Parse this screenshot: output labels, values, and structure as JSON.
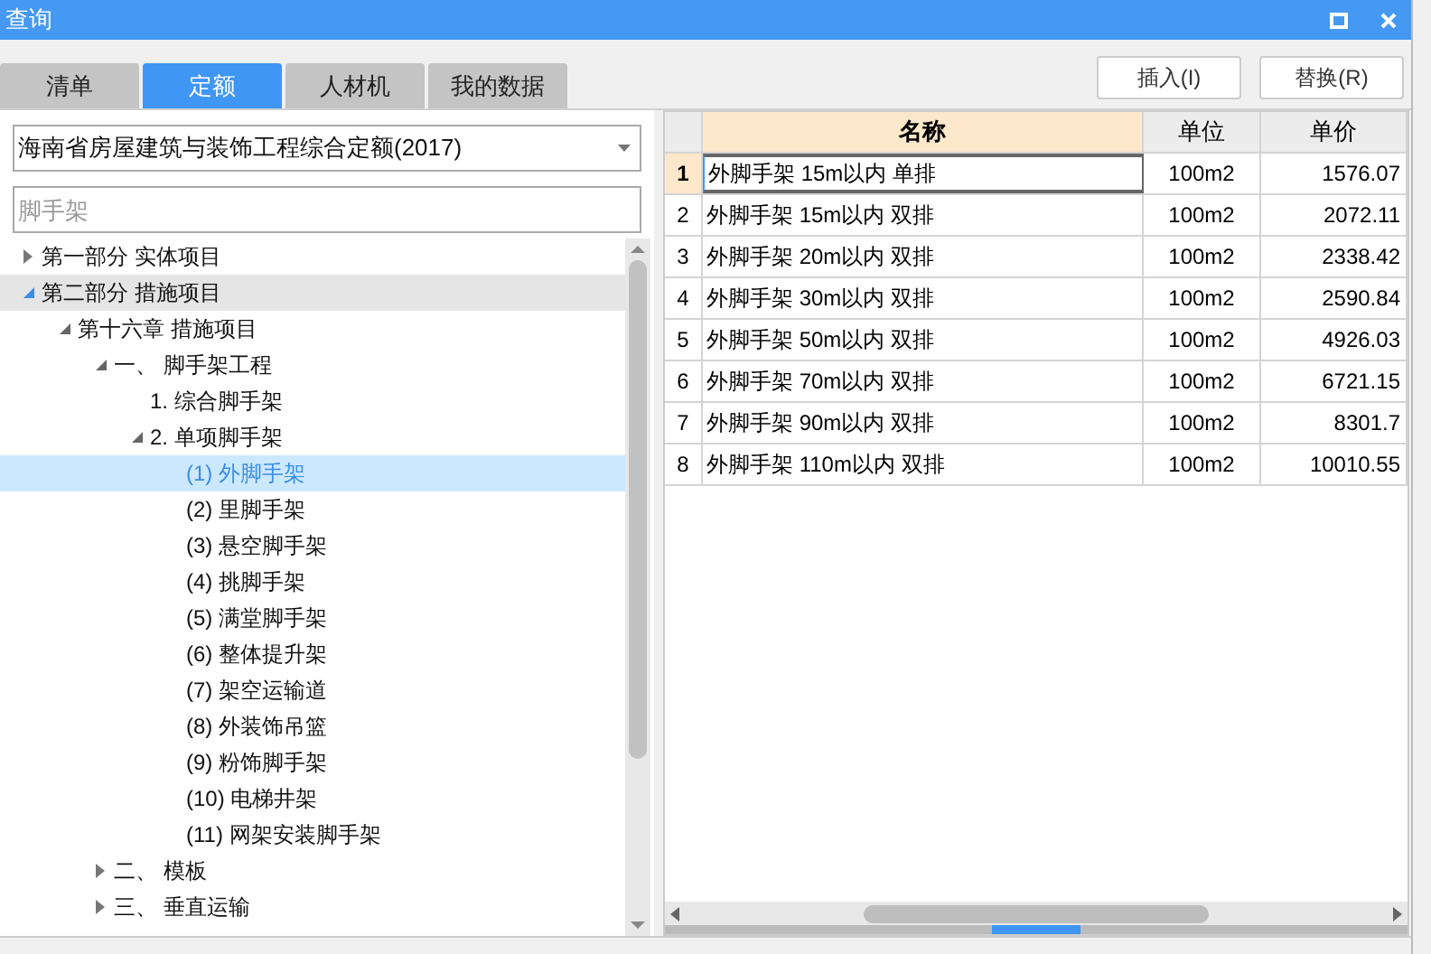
{
  "window": {
    "title": "查询"
  },
  "tabs": [
    {
      "label": "清单",
      "selected": false
    },
    {
      "label": "定额",
      "selected": true
    },
    {
      "label": "人材机",
      "selected": false
    },
    {
      "label": "我的数据",
      "selected": false
    }
  ],
  "buttons": [
    "插入(I)",
    "替换(R)"
  ],
  "quota_select": {
    "value": "海南省房屋建筑与装饰工程综合定额(2017)"
  },
  "search": {
    "placeholder": "脚手架"
  },
  "tree": [
    {
      "label": "第一部分 实体项目",
      "expanded": false,
      "selected": false,
      "highlighted": false
    },
    {
      "label": "第二部分 措施项目",
      "expanded": true,
      "selected": false,
      "highlighted": true,
      "children": [
        {
          "label": "第十六章 措施项目",
          "expanded": true,
          "selected": false,
          "highlighted": false,
          "children": [
            {
              "label": "一、 脚手架工程",
              "expanded": true,
              "selected": false,
              "highlighted": false,
              "children": [
                {
                  "label": "1. 综合脚手架",
                  "selected": false,
                  "highlighted": false
                },
                {
                  "label": "2. 单项脚手架",
                  "expanded": true,
                  "selected": false,
                  "highlighted": false,
                  "children": [
                    {
                      "label": "(1) 外脚手架",
                      "selected": true,
                      "highlighted": false
                    },
                    {
                      "label": "(2) 里脚手架",
                      "selected": false,
                      "highlighted": false
                    },
                    {
                      "label": "(3) 悬空脚手架",
                      "selected": false,
                      "highlighted": false
                    },
                    {
                      "label": "(4) 挑脚手架",
                      "selected": false,
                      "highlighted": false
                    },
                    {
                      "label": "(5) 满堂脚手架",
                      "selected": false,
                      "highlighted": false
                    },
                    {
                      "label": "(6) 整体提升架",
                      "selected": false,
                      "highlighted": false
                    },
                    {
                      "label": "(7) 架空运输道",
                      "selected": false,
                      "highlighted": false
                    },
                    {
                      "label": "(8) 外装饰吊篮",
                      "selected": false,
                      "highlighted": false
                    },
                    {
                      "label": "(9) 粉饰脚手架",
                      "selected": false,
                      "highlighted": false
                    },
                    {
                      "label": "(10) 电梯井架",
                      "selected": false,
                      "highlighted": false
                    },
                    {
                      "label": "(11) 网架安装脚手架",
                      "selected": false,
                      "highlighted": false
                    }
                  ]
                }
              ]
            },
            {
              "label": "二、 模板",
              "expanded": false,
              "selected": false,
              "highlighted": false
            },
            {
              "label": "三、 垂直运输",
              "expanded": false,
              "selected": false,
              "highlighted": false
            }
          ]
        }
      ]
    }
  ],
  "table": {
    "columns": [
      {
        "label": "名称",
        "selected": true
      },
      {
        "label": "单位",
        "selected": false
      },
      {
        "label": "单价",
        "selected": false
      }
    ],
    "rows": [
      {
        "index": "1",
        "name": "外脚手架 15m以内 单排",
        "unit": "100m2",
        "price": "1576.07",
        "selected": true
      },
      {
        "index": "2",
        "name": "外脚手架 15m以内 双排",
        "unit": "100m2",
        "price": "2072.11",
        "selected": false
      },
      {
        "index": "3",
        "name": "外脚手架 20m以内 双排",
        "unit": "100m2",
        "price": "2338.42",
        "selected": false
      },
      {
        "index": "4",
        "name": "外脚手架 30m以内 双排",
        "unit": "100m2",
        "price": "2590.84",
        "selected": false
      },
      {
        "index": "5",
        "name": "外脚手架 50m以内 双排",
        "unit": "100m2",
        "price": "4926.03",
        "selected": false
      },
      {
        "index": "6",
        "name": "外脚手架 70m以内 双排",
        "unit": "100m2",
        "price": "6721.15",
        "selected": false
      },
      {
        "index": "7",
        "name": "外脚手架 90m以内 双排",
        "unit": "100m2",
        "price": "8301.7",
        "selected": false
      },
      {
        "index": "8",
        "name": "外脚手架 110m以内 双排",
        "unit": "100m2",
        "price": "10010.55",
        "selected": false
      }
    ]
  }
}
